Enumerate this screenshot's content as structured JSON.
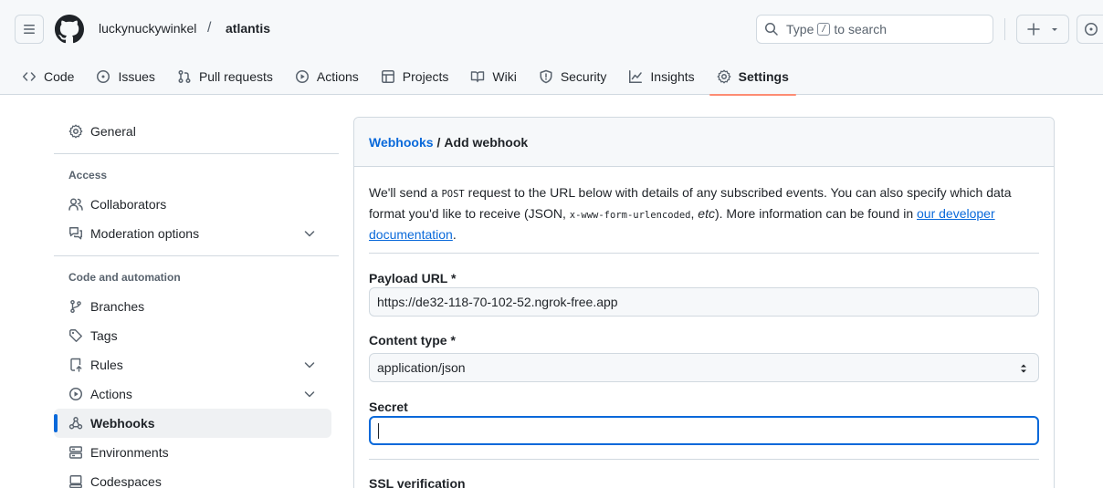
{
  "header": {
    "owner": "luckynuckywinkel",
    "separator": "/",
    "repo": "atlantis",
    "search": {
      "prefix": "Type",
      "key": "/",
      "suffix": "to search"
    }
  },
  "tabs": [
    {
      "label": "Code",
      "icon": "code-icon"
    },
    {
      "label": "Issues",
      "icon": "issue-opened-icon"
    },
    {
      "label": "Pull requests",
      "icon": "git-pull-request-icon"
    },
    {
      "label": "Actions",
      "icon": "play-icon"
    },
    {
      "label": "Projects",
      "icon": "table-icon"
    },
    {
      "label": "Wiki",
      "icon": "book-icon"
    },
    {
      "label": "Security",
      "icon": "shield-icon"
    },
    {
      "label": "Insights",
      "icon": "graph-icon"
    },
    {
      "label": "Settings",
      "icon": "gear-icon",
      "selected": true
    }
  ],
  "sidebar": {
    "general": "General",
    "access_heading": "Access",
    "collaborators": "Collaborators",
    "moderation": "Moderation options",
    "code_heading": "Code and automation",
    "branches": "Branches",
    "tags": "Tags",
    "rules": "Rules",
    "actions": "Actions",
    "webhooks": "Webhooks",
    "environments": "Environments",
    "codespaces": "Codespaces"
  },
  "main": {
    "breadcrumb_link": "Webhooks",
    "breadcrumb_sep": "/",
    "breadcrumb_current": "Add webhook",
    "intro": {
      "p1": "We'll send a ",
      "code1": "POST",
      "p2": " request to the URL below with details of any subscribed events. You can also specify which data format you'd like to receive (JSON, ",
      "code2": "x-www-form-urlencoded",
      "p3": ", ",
      "etc": "etc",
      "p4": "). More information can be found in ",
      "link": "our developer documentation",
      "p5": "."
    },
    "payload_label": "Payload URL *",
    "payload_value": "https://de32-118-70-102-52.ngrok-free.app",
    "content_type_label": "Content type *",
    "content_type_value": "application/json",
    "secret_label": "Secret",
    "ssl_label": "SSL verification"
  },
  "colors": {
    "accent": "#0969da",
    "tab_underline": "#fd8c73",
    "border": "#d1d9e0"
  }
}
